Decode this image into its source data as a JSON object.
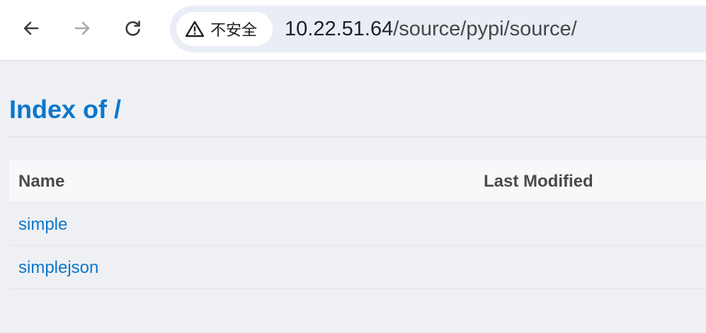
{
  "browser": {
    "security_label": "不安全",
    "url_host": "10.22.51.64",
    "url_path": "/source/pypi/source/"
  },
  "page": {
    "title": "Index of /"
  },
  "table": {
    "columns": [
      "Name",
      "Last Modified"
    ],
    "rows": [
      {
        "name": "simple",
        "modified": ""
      },
      {
        "name": "simplejson",
        "modified": ""
      }
    ]
  },
  "colors": {
    "link": "#0a77cc",
    "background": "#eff0f4",
    "header_text": "#4a4a4a"
  },
  "icons": [
    "back-arrow-icon",
    "forward-arrow-icon",
    "reload-icon",
    "warning-triangle-icon"
  ]
}
